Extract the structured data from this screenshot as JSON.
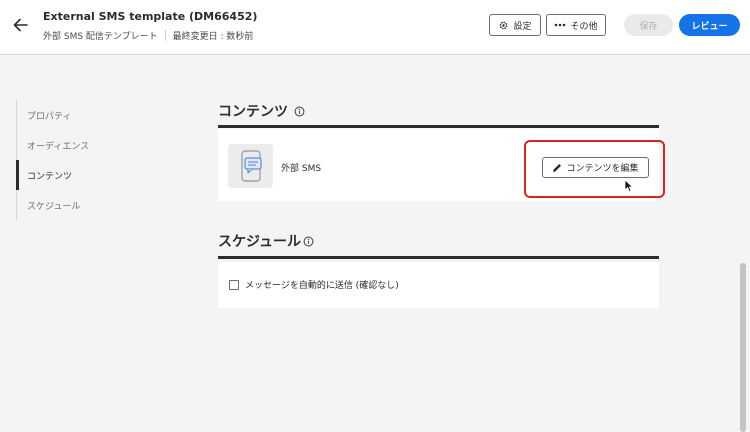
{
  "header": {
    "title": "External SMS template (DM66452)",
    "subtitle": "外部 SMS 配信テンプレート",
    "last_modified": "最終変更日 : 数秒前",
    "settings_label": "設定",
    "more_label": "その他",
    "save_label": "保存",
    "review_label": "レビュー"
  },
  "nav": {
    "items": [
      {
        "label": "プロパティ"
      },
      {
        "label": "オーディエンス"
      },
      {
        "label": "コンテンツ"
      },
      {
        "label": "スケジュール"
      }
    ],
    "active": "コンテンツ"
  },
  "content_section": {
    "title": "コンテンツ",
    "channel_label": "外部 SMS",
    "edit_button_label": "コンテンツを編集"
  },
  "schedule_section": {
    "title": "スケジュール",
    "checkbox_label": "メッセージを自動的に送信 (確認なし)",
    "checkbox_checked": false
  },
  "colors": {
    "primary": "#1473e6",
    "highlight": "#d7261e",
    "text": "#2c2c2c"
  },
  "icons": [
    "back-arrow-icon",
    "gear-icon",
    "more-icon",
    "info-icon",
    "sms-channel-icon",
    "pencil-icon",
    "mouse-cursor-icon"
  ]
}
